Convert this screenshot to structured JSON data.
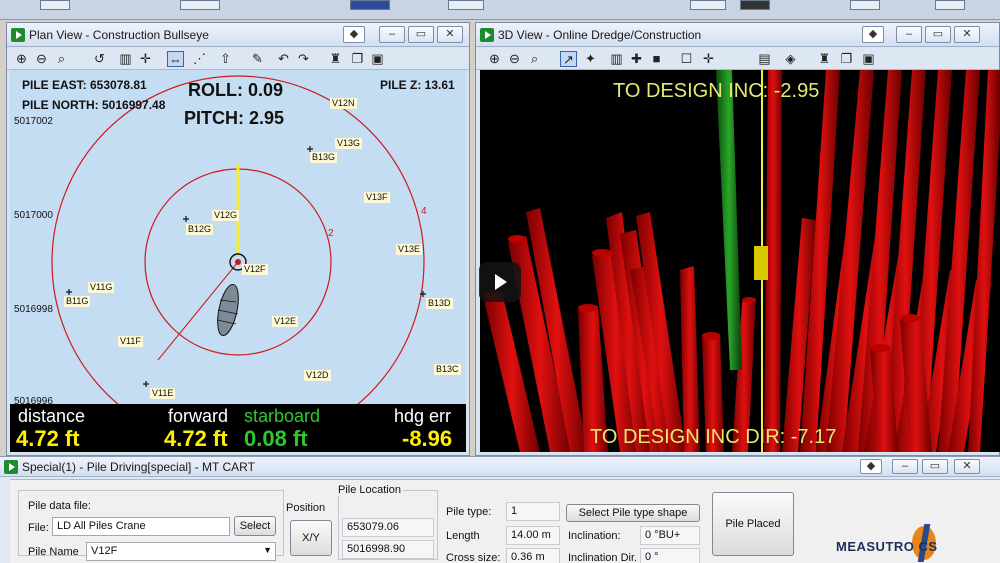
{
  "plan_view": {
    "title": "Plan View - Construction Bullseye",
    "pile_east": "PILE EAST: 653078.81",
    "pile_north": "PILE NORTH: 5016997.48",
    "roll": "ROLL: 0.09",
    "pitch": "PITCH: 2.95",
    "pile_z": "PILE Z: 13.61",
    "y_ticks": [
      "5017002",
      "5017000",
      "5016998",
      "5016996"
    ],
    "ring_labels": [
      "2",
      "4"
    ],
    "piles": [
      {
        "id": "V12N",
        "label": "V12N"
      },
      {
        "id": "V13G",
        "label": "V13G"
      },
      {
        "id": "B13G",
        "label": "B13G"
      },
      {
        "id": "V13F",
        "label": "V13F"
      },
      {
        "id": "V12G",
        "label": "V12G"
      },
      {
        "id": "B12G",
        "label": "B12G"
      },
      {
        "id": "V13E",
        "label": "V13E"
      },
      {
        "id": "V12F",
        "label": "V12F"
      },
      {
        "id": "V11G",
        "label": "V11G"
      },
      {
        "id": "B11G",
        "label": "B11G"
      },
      {
        "id": "B13D",
        "label": "B13D"
      },
      {
        "id": "V12E",
        "label": "V12E"
      },
      {
        "id": "V11F",
        "label": "V11F"
      },
      {
        "id": "B13C",
        "label": "B13C"
      },
      {
        "id": "V12D",
        "label": "V12D"
      },
      {
        "id": "V11E",
        "label": "V11E"
      }
    ],
    "readout": {
      "distance_label": "distance",
      "distance_value": "4.72 ft",
      "forward_label": "forward",
      "forward_value": "4.72 ft",
      "starboard_label": "starboard",
      "starboard_value": "0.08 ft",
      "hdg_label": "hdg err",
      "hdg_value": "-8.96"
    }
  },
  "view3d": {
    "title": "3D View - Online Dredge/Construction",
    "to_design_inc": "TO DESIGN INC: -2.95",
    "to_design_inc_dir": "TO DESIGN INC DIR: -7.17"
  },
  "special": {
    "title": "Special(1) - Pile Driving[special] - MT CART",
    "pile_data_file_label": "Pile data file:",
    "file_label": "File:",
    "file_value": "LD All Piles Crane",
    "select_button": "Select",
    "pile_name_label": "Pile Name",
    "pile_name_value": "V12F",
    "position_label": "Position",
    "xy_button": "X/Y",
    "pile_location_label": "Pile Location",
    "location_x": "653079.06",
    "location_y": "5016998.90",
    "pile_type_label": "Pile type:",
    "pile_type_value": "1",
    "select_pile_type_button": "Select Pile type shape",
    "length_label": "Length",
    "length_value": "14.00 m",
    "inclination_label": "Inclination:",
    "inclination_value": "0 °BU+",
    "cross_size_label": "Cross size:",
    "cross_size_value": "0.36 m",
    "inclination_dir_label": "Inclination Dir.",
    "inclination_dir_value": "0 °",
    "pile_placed_button": "Pile Placed",
    "logo_text": "MEASUTRO   CS"
  },
  "colors": {
    "canvas_plan": "#c5ddf3",
    "ring": "#cc1a1a",
    "readout_value": "#ffee00",
    "starboard": "#2ec82e",
    "overlay_text": "#e8e870"
  }
}
